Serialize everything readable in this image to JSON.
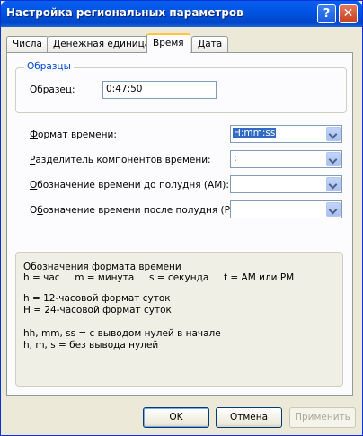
{
  "window": {
    "title": "Настройка региональных параметров",
    "help_label": "?",
    "close_label": "✕"
  },
  "tabs": [
    "Числа",
    "Денежная единица",
    "Время",
    "Дата"
  ],
  "active_tab": "Время",
  "samples": {
    "group_title": "Образцы",
    "label": "Образец:",
    "value": "0:47:50"
  },
  "fields": {
    "time_format": {
      "label_first": "Ф",
      "label_rest": "ормат времени:",
      "value": "H:mm:ss"
    },
    "separator": {
      "label_first": "Р",
      "label_rest": "азделитель компонентов времени:",
      "value": ":"
    },
    "am_symbol": {
      "label_first": "О",
      "label_rest": "бозначение времени до полудня (AM):",
      "value": ""
    },
    "pm_symbol": {
      "label_prefix": "О",
      "label_underlined": "б",
      "label_rest": "означение времени после полудня (PM):",
      "value": ""
    }
  },
  "info": {
    "title": "Обозначения формата времени",
    "line1": "h = час     m = минута     s = секунда     t = AM или PM",
    "line2": "h = 12-часовой формат суток",
    "line3": "H = 24-часовой формат суток",
    "line4": "hh, mm, ss = с выводом нулей в начале",
    "line5": "h, m, s = без вывода нулей"
  },
  "buttons": {
    "ok": "OK",
    "cancel": "Отмена",
    "apply": "Применить"
  },
  "colors": {
    "title_bar": "#0054e3",
    "group_title": "#0046d5",
    "selection": "#316ac5"
  }
}
